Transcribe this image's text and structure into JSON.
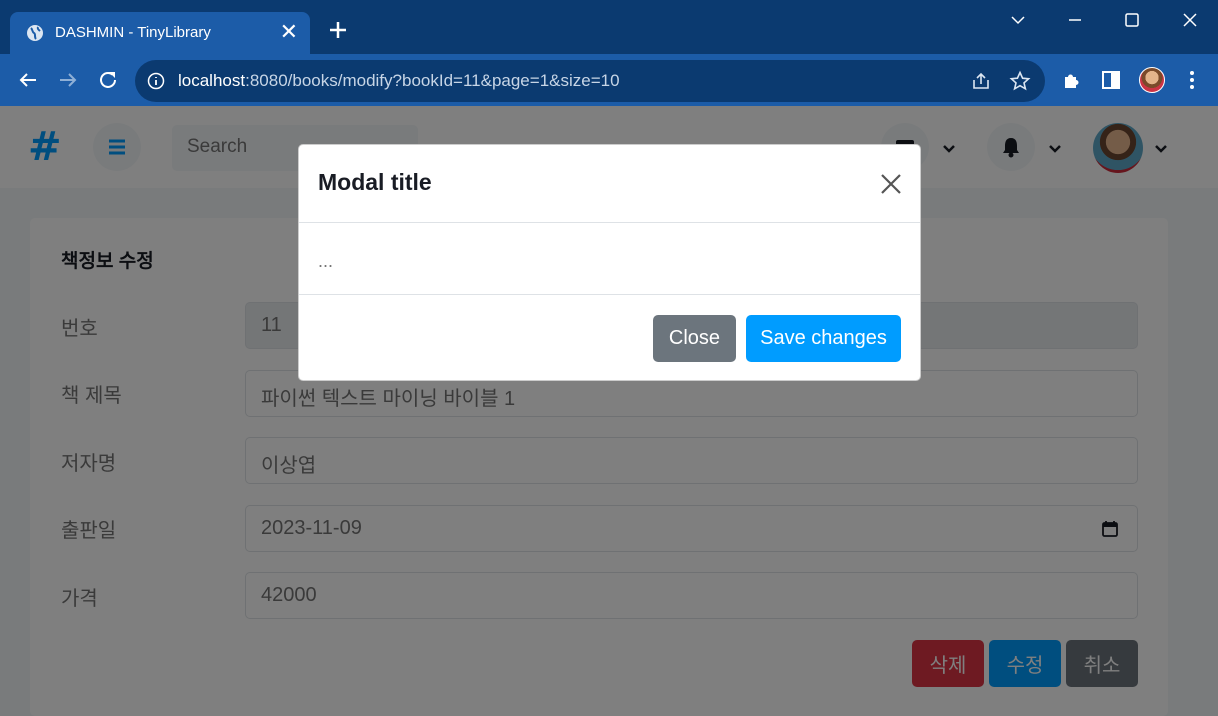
{
  "browser": {
    "tab_title": "DASHMIN - TinyLibrary",
    "tab_close": "✕",
    "url_host": "localhost",
    "url_rest": ":8080/books/modify?bookId=11&page=1&size=10"
  },
  "topnav": {
    "brand": "#",
    "search_placeholder": "Search"
  },
  "form": {
    "title": "책정보 수정",
    "fields": [
      {
        "label": "번호",
        "value": "11"
      },
      {
        "label": "책 제목",
        "value": "파이썬 텍스트 마이닝 바이블 1"
      },
      {
        "label": "저자명",
        "value": "이상엽"
      },
      {
        "label": "출판일",
        "value": "2023-11-09"
      },
      {
        "label": "가격",
        "value": "42000"
      }
    ],
    "buttons": {
      "delete": "삭제",
      "modify": "수정",
      "cancel": "취소"
    }
  },
  "modal": {
    "title": "Modal title",
    "body": "...",
    "close_label": "Close",
    "save_label": "Save changes"
  },
  "colors": {
    "primary": "#009cff",
    "danger": "#dc3545",
    "secondary": "#6c757d",
    "browser_dark": "#0b3a70",
    "browser_mid": "#1c5ca8"
  }
}
